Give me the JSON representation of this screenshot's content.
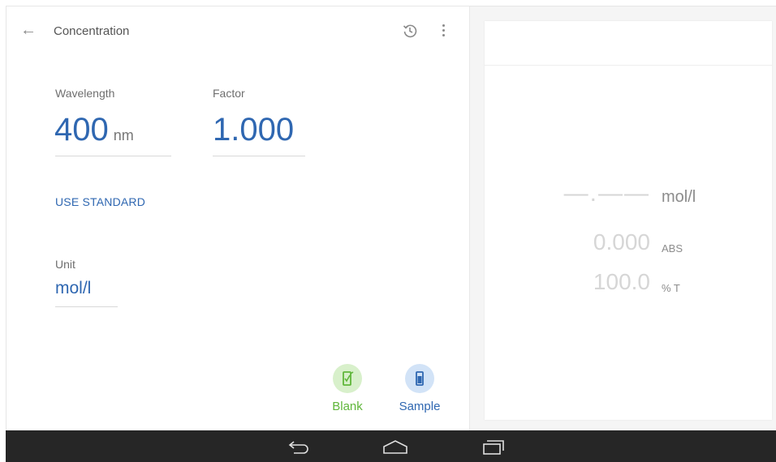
{
  "header": {
    "title": "Concentration",
    "back_icon": "arrow-back-icon",
    "history_icon": "history-icon",
    "menu_icon": "more-vert-icon"
  },
  "wavelength": {
    "label": "Wavelength",
    "value": "400",
    "unit": "nm"
  },
  "factor": {
    "label": "Factor",
    "value": "1.000"
  },
  "use_standard": "USE STANDARD",
  "unit_field": {
    "label": "Unit",
    "value": "mol/l"
  },
  "actions": {
    "blank": {
      "label": "Blank",
      "color": "#5fb63a",
      "bg": "#d8f0cb"
    },
    "sample": {
      "label": "Sample",
      "color": "#2f67b1",
      "bg": "#d2e3f7"
    }
  },
  "results": {
    "concentration": {
      "value": "—.——",
      "unit": "mol/l"
    },
    "absorbance": {
      "value": "0.000",
      "unit": "ABS"
    },
    "transmittance": {
      "value": "100.0",
      "unit": "% T"
    }
  },
  "colors": {
    "accent": "#2f67b1",
    "navbar": "#262626"
  }
}
